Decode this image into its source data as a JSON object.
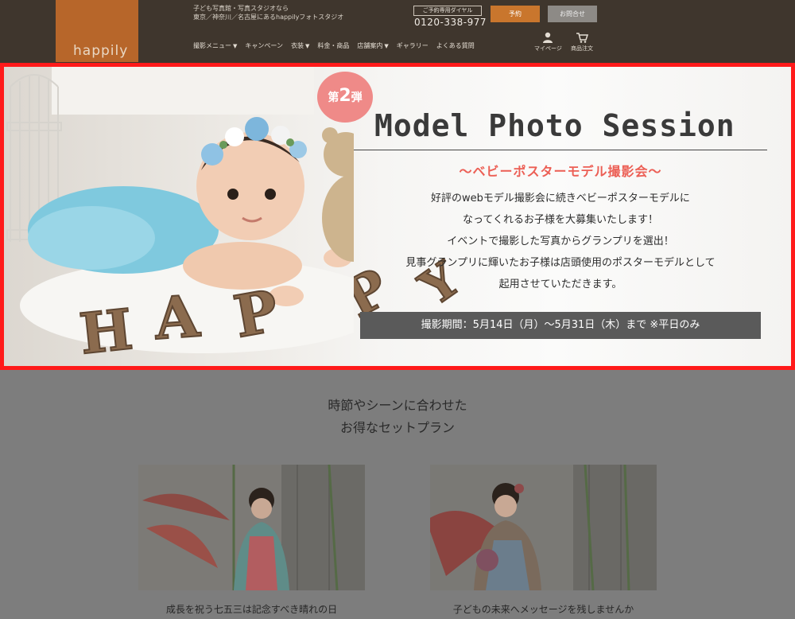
{
  "header": {
    "logo": "happily",
    "tagline_line1": "子ども写真館・写真スタジオなら",
    "tagline_line2": "東京／神奈川／名古屋にあるhappilyフォトスタジオ",
    "phone_label": "ご予約専用ダイヤル",
    "phone_number": "0120-338-977",
    "reserve_label": "予約",
    "contact_label": "お問合せ",
    "nav": [
      {
        "label": "撮影メニュー",
        "chevron": true
      },
      {
        "label": "キャンペーン",
        "chevron": false
      },
      {
        "label": "衣装",
        "chevron": true
      },
      {
        "label": "料金・商品",
        "chevron": false
      },
      {
        "label": "店舗案内",
        "chevron": true
      },
      {
        "label": "ギャラリー",
        "chevron": false
      },
      {
        "label": "よくある質問",
        "chevron": false
      }
    ],
    "mypage_label": "マイページ",
    "order_label": "商品注文",
    "colors": {
      "bg": "#3f362d",
      "logo_bg": "#b7662a",
      "reserve": "#c9762d"
    }
  },
  "hero": {
    "badge_prefix": "第",
    "badge_number": "2",
    "badge_suffix": "弾",
    "title": "Model Photo Session",
    "subtitle": "～ベビーポスターモデル撮影会～",
    "desc_lines": [
      "好評のwebモデル撮影会に続きベビーポスターモデルに",
      "なってくれるお子様を大募集いたします！",
      "イベントで撮影した写真からグランプリを選出！",
      "見事グランプリに輝いたお子様は店頭使用のポスターモデルとして",
      "起用させていただきます。"
    ],
    "period": "撮影期間：5月14日（月）～5月31日（木）まで ※平日のみ",
    "letters": [
      "H",
      "A",
      "P",
      "P",
      "Y"
    ],
    "colors": {
      "badge": "#ef8a88",
      "subtitle": "#ec5f55",
      "period_bg": "#5a5a5a",
      "highlight_border": "#ff1a1a"
    }
  },
  "plans": {
    "title_line1": "時節やシーンに合わせた",
    "title_line2": "お得なセットプラン",
    "cards": [
      {
        "caption": "成長を祝う七五三は記念すべき晴れの日"
      },
      {
        "caption": "子どもの未来へメッセージを残しませんか"
      }
    ]
  }
}
